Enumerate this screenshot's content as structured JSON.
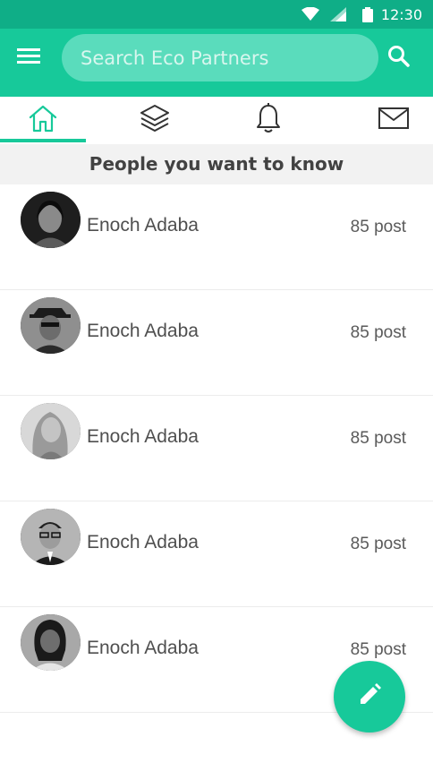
{
  "status_bar": {
    "time": "12:30",
    "icons": [
      "wifi-icon",
      "signal-icon",
      "battery-icon"
    ]
  },
  "app_bar": {
    "menu_icon": "hamburger-menu-icon",
    "search": {
      "placeholder": "Search Eco Partners",
      "value": ""
    },
    "search_icon": "search-icon"
  },
  "tabs": [
    {
      "icon": "home-icon",
      "active": true
    },
    {
      "icon": "layers-icon",
      "active": false
    },
    {
      "icon": "bell-icon",
      "active": false
    },
    {
      "icon": "mail-icon",
      "active": false
    }
  ],
  "section": {
    "title": "People you want to know"
  },
  "people": [
    {
      "name": "Enoch Adaba",
      "posts": "85 post"
    },
    {
      "name": "Enoch Adaba",
      "posts": "85 post"
    },
    {
      "name": "Enoch Adaba",
      "posts": "85 post"
    },
    {
      "name": "Enoch Adaba",
      "posts": "85 post"
    },
    {
      "name": "Enoch Adaba",
      "posts": "85 post"
    }
  ],
  "fab": {
    "icon": "pencil-icon"
  },
  "colors": {
    "primary": "#17c99a",
    "primary_dark": "#0fae87",
    "search_bg": "#5adcbc",
    "header_bg": "#f2f2f2"
  }
}
